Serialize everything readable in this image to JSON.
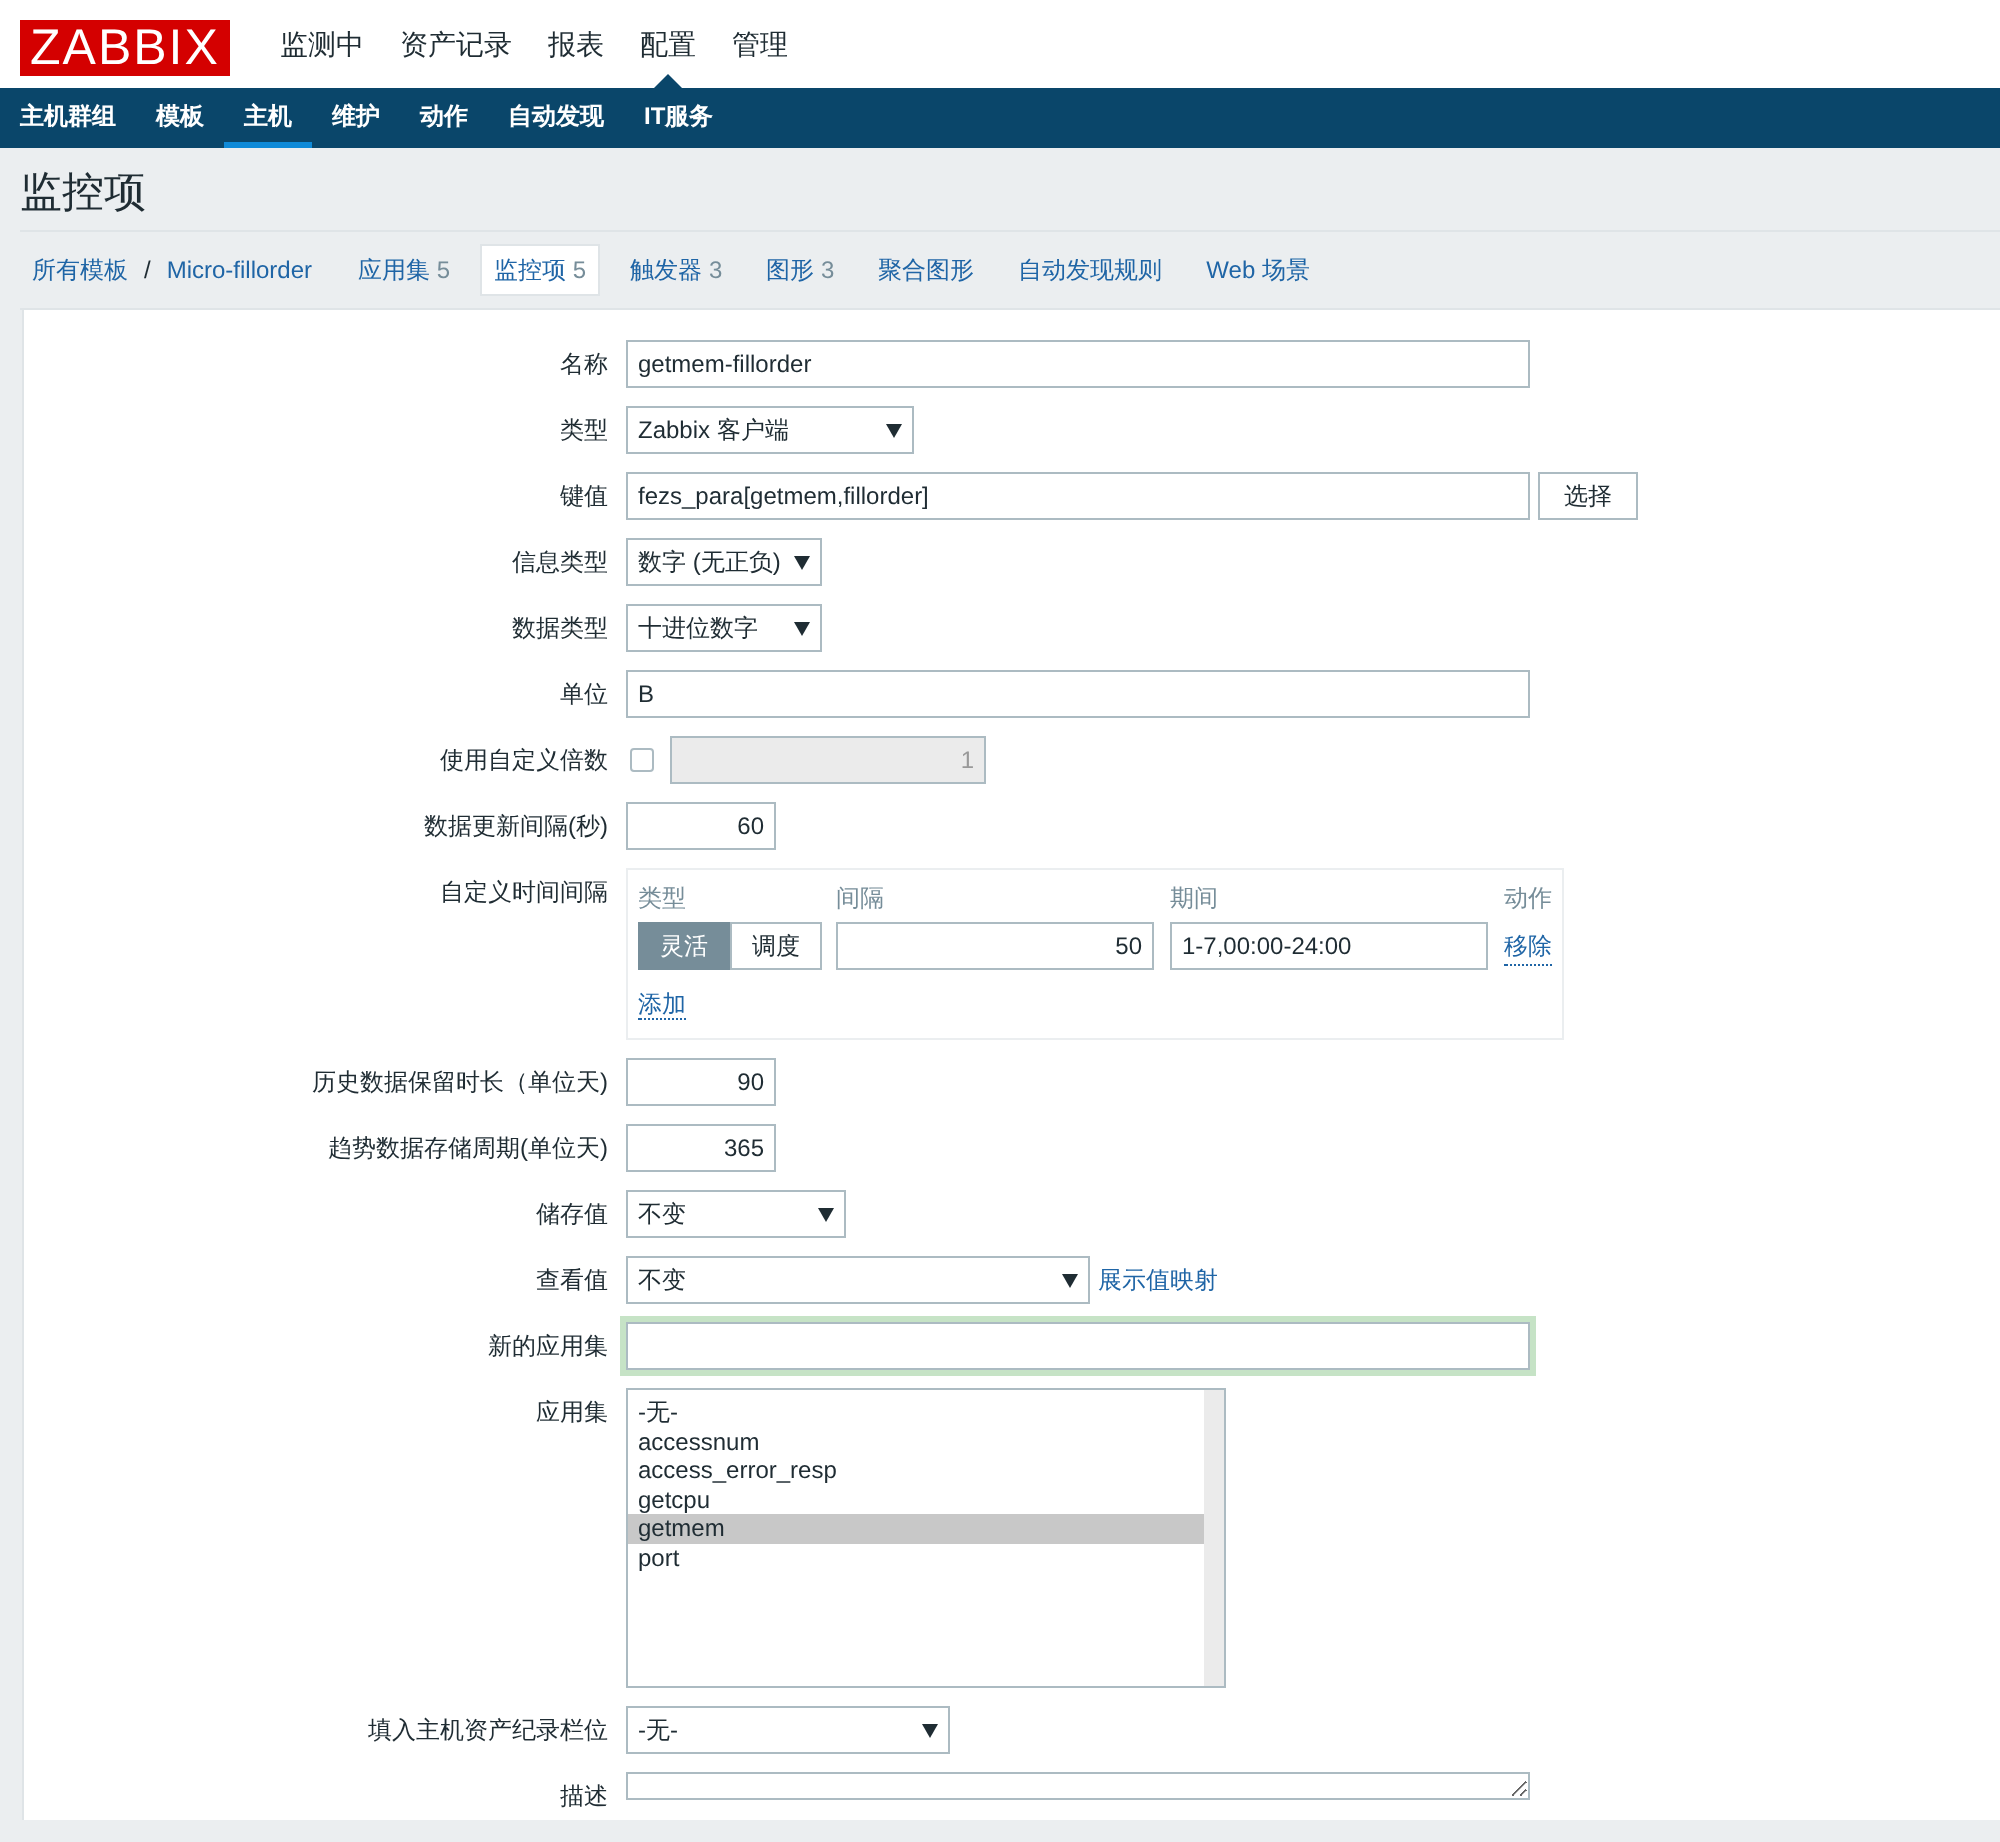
{
  "logo": "ZABBIX",
  "main_menu": [
    {
      "label": "监测中",
      "selected": false
    },
    {
      "label": "资产记录",
      "selected": false
    },
    {
      "label": "报表",
      "selected": false
    },
    {
      "label": "配置",
      "selected": true
    },
    {
      "label": "管理",
      "selected": false
    }
  ],
  "sub_menu": [
    {
      "label": "主机群组",
      "selected": false
    },
    {
      "label": "模板",
      "selected": false
    },
    {
      "label": "主机",
      "selected": true
    },
    {
      "label": "维护",
      "selected": false
    },
    {
      "label": "动作",
      "selected": false
    },
    {
      "label": "自动发现",
      "selected": false
    },
    {
      "label": "IT服务",
      "selected": false
    }
  ],
  "page_title": "监控项",
  "breadcrumb": {
    "items": [
      "所有模板",
      "Micro-fillorder"
    ],
    "separator": "/"
  },
  "tabs": [
    {
      "label": "应用集",
      "count": "5",
      "selected": false
    },
    {
      "label": "监控项",
      "count": "5",
      "selected": true
    },
    {
      "label": "触发器",
      "count": "3",
      "selected": false
    },
    {
      "label": "图形",
      "count": "3",
      "selected": false
    },
    {
      "label": "聚合图形",
      "selected": false
    },
    {
      "label": "自动发现规则",
      "selected": false
    },
    {
      "label": "Web 场景",
      "selected": false
    }
  ],
  "form": [
    {
      "kind": "text",
      "label": "名称",
      "value": "getmem-fillorder"
    },
    {
      "kind": "select",
      "label": "类型",
      "value": "Zabbix 客户端"
    },
    {
      "kind": "text_button",
      "label": "键值",
      "value": "fezs_para[getmem,fillorder]",
      "button": "选择"
    },
    {
      "kind": "select",
      "label": "信息类型",
      "value": "数字 (无正负)"
    },
    {
      "kind": "select",
      "label": "数据类型",
      "value": "十进位数字"
    },
    {
      "kind": "text",
      "label": "单位",
      "value": "B"
    },
    {
      "kind": "checkbox_number",
      "label": "使用自定义倍数",
      "checked": false,
      "disabled": true,
      "value": "1"
    },
    {
      "kind": "number",
      "label": "数据更新间隔(秒)",
      "value": "60"
    },
    {
      "kind": "intervals",
      "label": "自定义时间间隔",
      "columns": [
        "类型",
        "间隔",
        "期间",
        "动作"
      ],
      "rows": [
        {
          "modes": [
            {
              "label": "灵活",
              "selected": true
            },
            {
              "label": "调度",
              "selected": false
            }
          ],
          "interval": "50",
          "period": "1-7,00:00-24:00",
          "action": "移除"
        }
      ],
      "add": "添加"
    },
    {
      "kind": "number",
      "label": "历史数据保留时长（单位天)",
      "value": "90"
    },
    {
      "kind": "number",
      "label": "趋势数据存储周期(单位天)",
      "value": "365"
    },
    {
      "kind": "select",
      "label": "储存值",
      "value": "不变"
    },
    {
      "kind": "select",
      "label": "查看值",
      "value": "不变",
      "link": "展示值映射"
    },
    {
      "kind": "text",
      "label": "新的应用集",
      "focused": true
    },
    {
      "kind": "listbox",
      "label": "应用集",
      "options": [
        {
          "label": "-无-",
          "selected": false
        },
        {
          "label": "accessnum",
          "selected": false
        },
        {
          "label": "access_error_resp",
          "selected": false
        },
        {
          "label": "getcpu",
          "selected": false
        },
        {
          "label": "getmem",
          "selected": true
        },
        {
          "label": "port",
          "selected": false
        }
      ]
    },
    {
      "kind": "select",
      "label": "填入主机资产纪录栏位",
      "value": "-无-"
    },
    {
      "kind": "textarea",
      "label": "描述"
    }
  ]
}
